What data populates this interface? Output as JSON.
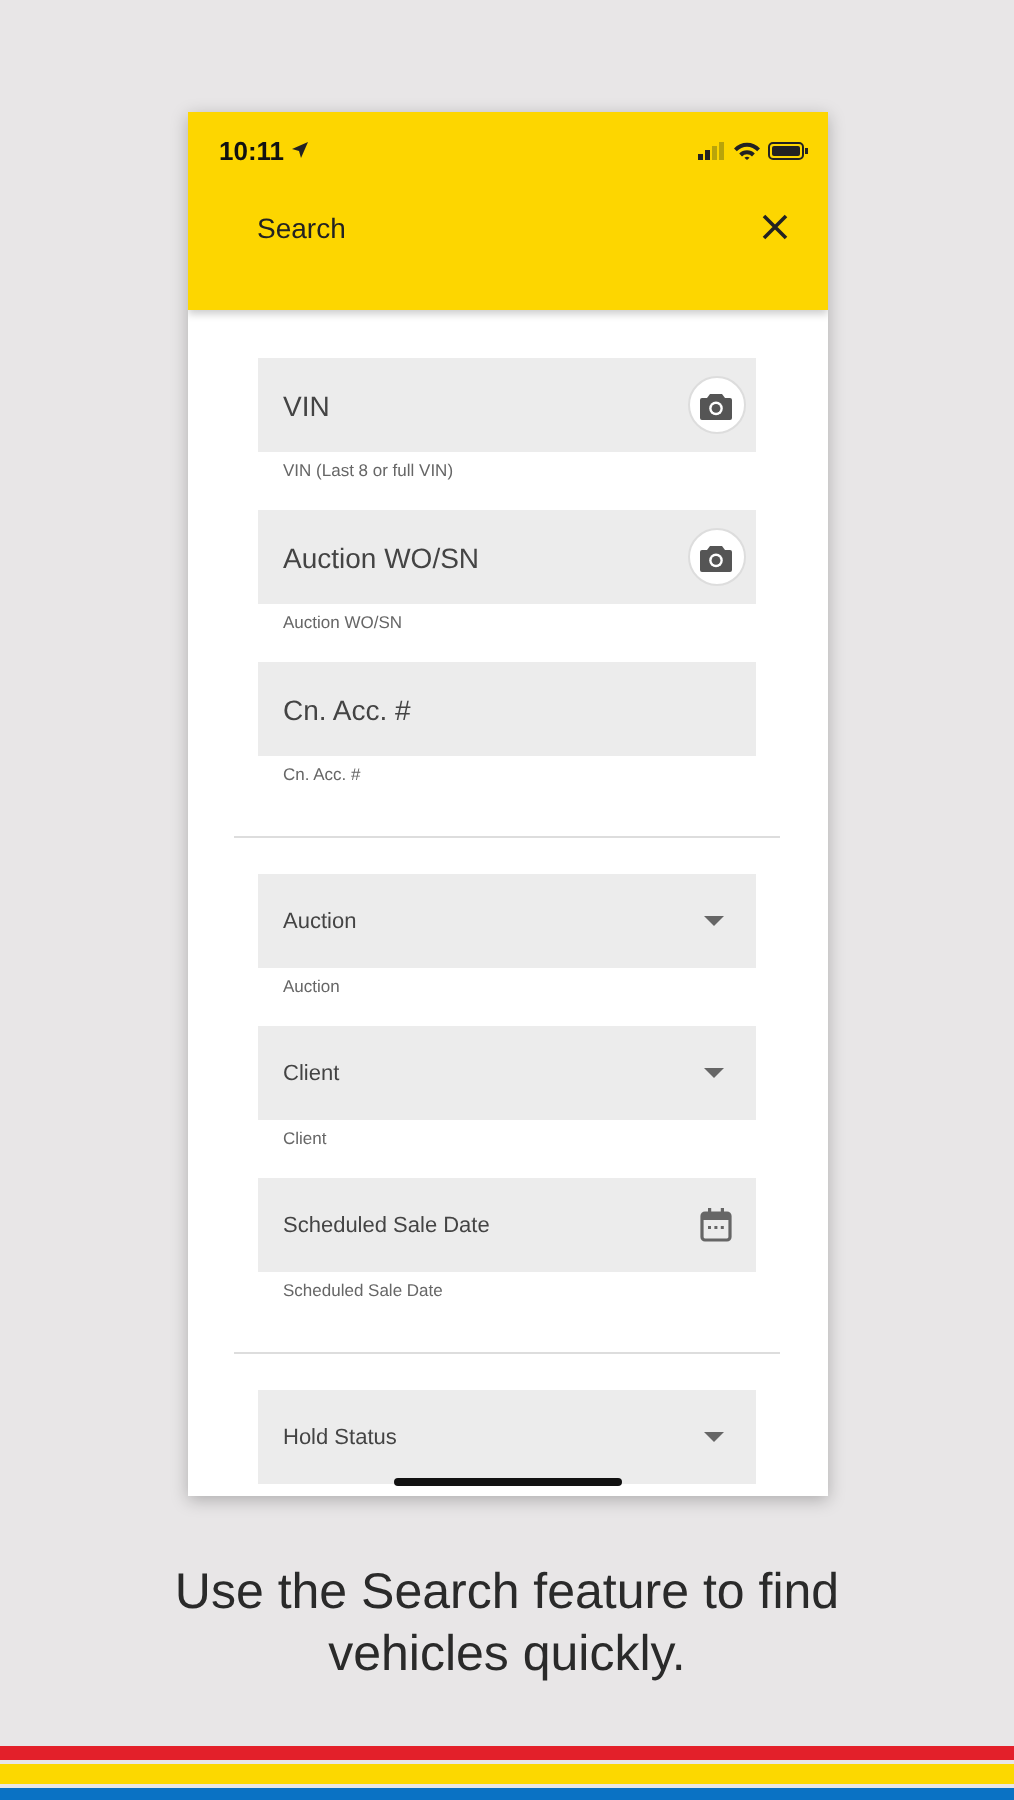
{
  "status_bar": {
    "time": "10:11"
  },
  "header": {
    "title": "Search"
  },
  "sections": [
    {
      "fields": [
        {
          "kind": "camera",
          "label": "VIN",
          "helper": "VIN (Last 8 or full VIN)"
        },
        {
          "kind": "camera",
          "label": "Auction WO/SN",
          "helper": "Auction WO/SN"
        },
        {
          "kind": "text",
          "label": "Cn. Acc. #",
          "helper": "Cn. Acc. #"
        }
      ]
    },
    {
      "fields": [
        {
          "kind": "dropdown",
          "label": "Auction",
          "helper": "Auction"
        },
        {
          "kind": "dropdown",
          "label": "Client",
          "helper": "Client"
        },
        {
          "kind": "date",
          "label": "Scheduled Sale Date",
          "helper": "Scheduled Sale Date"
        }
      ]
    },
    {
      "fields": [
        {
          "kind": "dropdown",
          "label": "Hold Status"
        }
      ]
    }
  ],
  "caption": "Use the Search feature to find vehicles quickly."
}
